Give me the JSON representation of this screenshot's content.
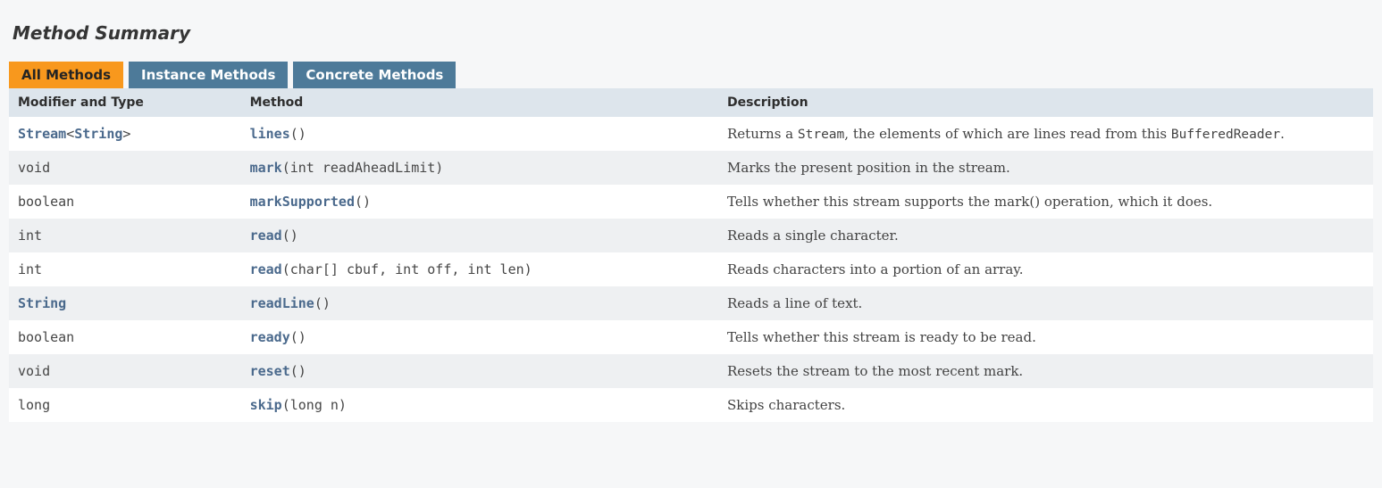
{
  "heading": "Method Summary",
  "tabs": [
    {
      "label": "All Methods",
      "active": true
    },
    {
      "label": "Instance Methods",
      "active": false
    },
    {
      "label": "Concrete Methods",
      "active": false
    }
  ],
  "columns": {
    "type": "Modifier and Type",
    "method": "Method",
    "description": "Description"
  },
  "rows": [
    {
      "type_parts": [
        {
          "text": "Stream",
          "link": true
        },
        {
          "text": "<",
          "link": false
        },
        {
          "text": "String",
          "link": true
        },
        {
          "text": ">",
          "link": false
        }
      ],
      "method_name": "lines",
      "params": "()",
      "desc_parts": [
        {
          "text": "Returns a ",
          "code": false
        },
        {
          "text": "Stream",
          "code": true
        },
        {
          "text": ", the elements of which are lines read from this ",
          "code": false
        },
        {
          "text": "BufferedReader",
          "code": true
        },
        {
          "text": ".",
          "code": false
        }
      ]
    },
    {
      "type_parts": [
        {
          "text": "void",
          "link": false
        }
      ],
      "method_name": "mark",
      "params": "(int readAheadLimit)",
      "desc_parts": [
        {
          "text": "Marks the present position in the stream.",
          "code": false
        }
      ]
    },
    {
      "type_parts": [
        {
          "text": "boolean",
          "link": false
        }
      ],
      "method_name": "markSupported",
      "params": "()",
      "desc_parts": [
        {
          "text": "Tells whether this stream supports the mark() operation, which it does.",
          "code": false
        }
      ]
    },
    {
      "type_parts": [
        {
          "text": "int",
          "link": false
        }
      ],
      "method_name": "read",
      "params": "()",
      "desc_parts": [
        {
          "text": "Reads a single character.",
          "code": false
        }
      ]
    },
    {
      "type_parts": [
        {
          "text": "int",
          "link": false
        }
      ],
      "method_name": "read",
      "params": "(char[] cbuf, int off, int len)",
      "desc_parts": [
        {
          "text": "Reads characters into a portion of an array.",
          "code": false
        }
      ]
    },
    {
      "type_parts": [
        {
          "text": "String",
          "link": true
        }
      ],
      "method_name": "readLine",
      "params": "()",
      "desc_parts": [
        {
          "text": "Reads a line of text.",
          "code": false
        }
      ]
    },
    {
      "type_parts": [
        {
          "text": "boolean",
          "link": false
        }
      ],
      "method_name": "ready",
      "params": "()",
      "desc_parts": [
        {
          "text": "Tells whether this stream is ready to be read.",
          "code": false
        }
      ]
    },
    {
      "type_parts": [
        {
          "text": "void",
          "link": false
        }
      ],
      "method_name": "reset",
      "params": "()",
      "desc_parts": [
        {
          "text": "Resets the stream to the most recent mark.",
          "code": false
        }
      ]
    },
    {
      "type_parts": [
        {
          "text": "long",
          "link": false
        }
      ],
      "method_name": "skip",
      "params": "(long n)",
      "desc_parts": [
        {
          "text": "Skips characters.",
          "code": false
        }
      ]
    }
  ]
}
